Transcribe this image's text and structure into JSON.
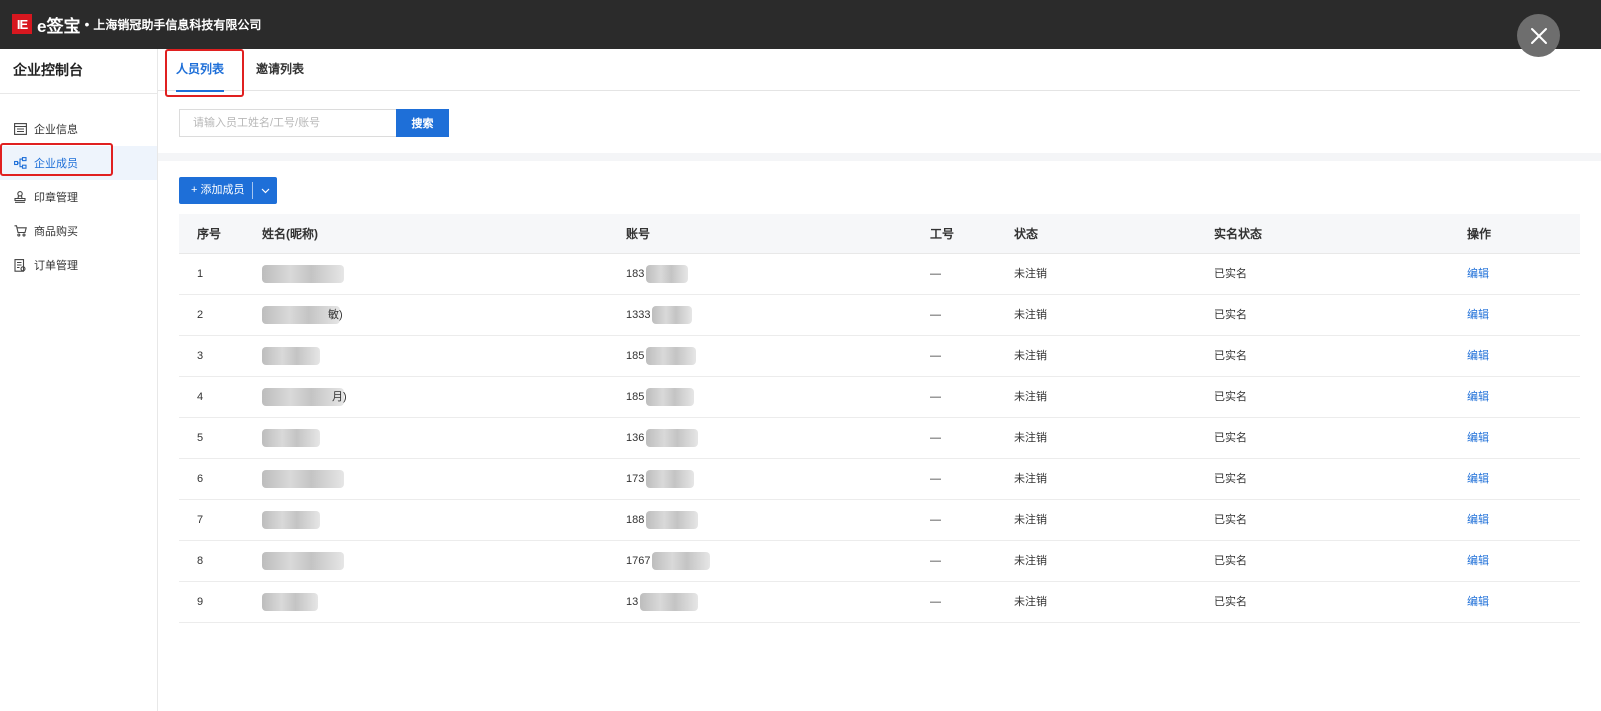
{
  "header": {
    "logo_text": "IE",
    "brand": "e签宝",
    "separator": "•",
    "company": "上海销冠助手信息科技有限公司"
  },
  "sidebar": {
    "title": "企业控制台",
    "items": [
      {
        "label": "企业信息",
        "icon": "building-info-icon"
      },
      {
        "label": "企业成员",
        "icon": "org-members-icon",
        "active": true
      },
      {
        "label": "印章管理",
        "icon": "seal-stamp-icon"
      },
      {
        "label": "商品购买",
        "icon": "cart-icon"
      },
      {
        "label": "订单管理",
        "icon": "order-doc-icon"
      }
    ]
  },
  "tabs": [
    {
      "label": "人员列表",
      "active": true
    },
    {
      "label": "邀请列表"
    }
  ],
  "search": {
    "placeholder": "请输入员工姓名/工号/账号",
    "value": "",
    "button": "搜索"
  },
  "toolbar": {
    "add_label": "+ 添加成员"
  },
  "table": {
    "columns": [
      "序号",
      "姓名(昵称)",
      "账号",
      "工号",
      "状态",
      "实名状态",
      "操作"
    ],
    "rows": [
      {
        "seq": "1",
        "name_visible": "",
        "account_prefix": "183",
        "no": "—",
        "status": "未注销",
        "real": "已实名",
        "op": "编辑"
      },
      {
        "seq": "2",
        "name_visible": "敏)",
        "account_prefix": "1333",
        "no": "—",
        "status": "未注销",
        "real": "已实名",
        "op": "编辑"
      },
      {
        "seq": "3",
        "name_visible": "",
        "account_prefix": "185",
        "no": "—",
        "status": "未注销",
        "real": "已实名",
        "op": "编辑"
      },
      {
        "seq": "4",
        "name_visible": "月)",
        "account_prefix": "185",
        "no": "—",
        "status": "未注销",
        "real": "已实名",
        "op": "编辑"
      },
      {
        "seq": "5",
        "name_visible": "",
        "account_prefix": "136",
        "no": "—",
        "status": "未注销",
        "real": "已实名",
        "op": "编辑"
      },
      {
        "seq": "6",
        "name_visible": "",
        "account_prefix": "173",
        "no": "—",
        "status": "未注销",
        "real": "已实名",
        "op": "编辑"
      },
      {
        "seq": "7",
        "name_visible": "",
        "account_prefix": "188",
        "no": "—",
        "status": "未注销",
        "real": "已实名",
        "op": "编辑"
      },
      {
        "seq": "8",
        "name_visible": "",
        "account_prefix": "1767",
        "no": "—",
        "status": "未注销",
        "real": "已实名",
        "op": "编辑"
      },
      {
        "seq": "9",
        "name_visible": "",
        "account_prefix": "13",
        "no": "—",
        "status": "未注销",
        "real": "已实名",
        "op": "编辑"
      }
    ]
  },
  "colors": {
    "topbar": "#2b2b2b",
    "accent": "#1e6fd8",
    "logo": "#d7171f",
    "highlight_box": "#e02020"
  }
}
